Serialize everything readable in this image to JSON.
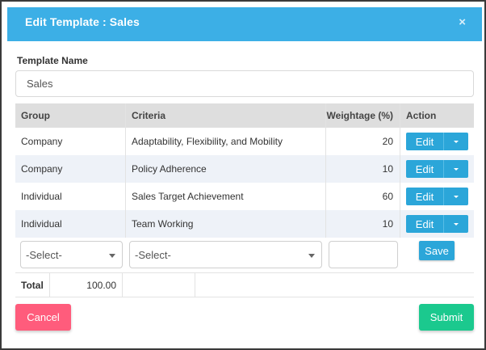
{
  "header": {
    "title": "Edit Template :  Sales",
    "close_glyph": "×"
  },
  "form": {
    "template_name_label": "Template Name",
    "template_name_value": "Sales"
  },
  "table": {
    "columns": [
      "Group",
      "Criteria",
      "Weightage (%)",
      "Action"
    ],
    "rows": [
      {
        "group": "Company",
        "criteria": "Adaptability, Flexibility, and Mobility",
        "weightage": "20",
        "action": "Edit"
      },
      {
        "group": "Company",
        "criteria": "Policy Adherence",
        "weightage": "10",
        "action": "Edit"
      },
      {
        "group": "Individual",
        "criteria": "Sales Target Achievement",
        "weightage": "60",
        "action": "Edit"
      },
      {
        "group": "Individual",
        "criteria": "Team Working",
        "weightage": "10",
        "action": "Edit"
      }
    ],
    "add_row": {
      "group_select": "-Select-",
      "criteria_select": "-Select-",
      "weightage_value": "",
      "save_label": "Save"
    },
    "total": {
      "label": "Total",
      "value": "100.00"
    }
  },
  "footer": {
    "cancel_label": "Cancel",
    "submit_label": "Submit"
  },
  "colors": {
    "header": "#3cafe6",
    "button_blue": "#2ba6d9",
    "cancel": "#ff5c7c",
    "submit": "#1bc98e"
  },
  "icons": {
    "close": "close-icon",
    "edit_dropdown": "chevron-down-icon",
    "select_dropdown": "chevron-down-icon"
  }
}
